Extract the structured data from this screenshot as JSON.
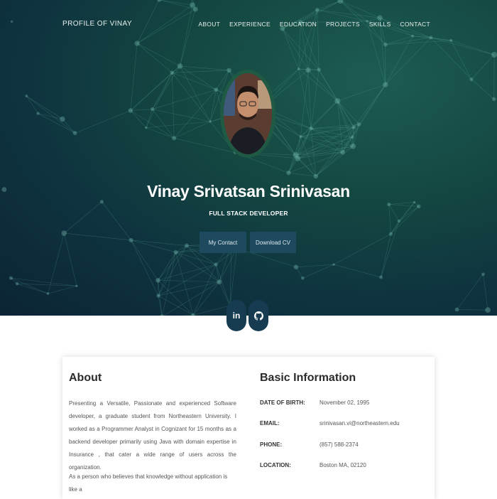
{
  "nav": {
    "brand": "PROFILE OF VINAY",
    "items": [
      "ABOUT",
      "EXPERIENCE",
      "EDUCATION",
      "PROJECTS",
      "SKILLS",
      "CONTACT"
    ]
  },
  "hero": {
    "name": "Vinay Srivatsan Srinivasan",
    "role": "FULL STACK DEVELOPER",
    "buttons": {
      "contact": "My Contact",
      "cv": "Download CV"
    }
  },
  "social": {
    "linkedin": "in"
  },
  "about": {
    "title": "About",
    "paragraph1": "Presenting a Versatile, Passionate and experienced Software developer, a graduate student from Northeastern University. I worked as a Programmer Analyst in Cognizant for 15 months as a backend developer primarily using Java with domain expertise in Insurance , that cater a wide range of users across the organization.",
    "paragraph2": "As a person who believes that knowledge without application is like a"
  },
  "basic_info": {
    "title": "Basic Information",
    "rows": [
      {
        "label": "DATE OF BIRTH:",
        "value": "November 02, 1995"
      },
      {
        "label": "EMAIL:",
        "value": "srinivasan.vi@northeastern.edu"
      },
      {
        "label": "PHONE:",
        "value": "(857) 588-2374"
      },
      {
        "label": "LOCATION:",
        "value": "Boston MA, 02120"
      }
    ]
  },
  "colors": {
    "hero_dark": "#0b2436",
    "hero_teal": "#1d5c52",
    "button": "#1e4a60",
    "social": "#173c52"
  },
  "icons": [
    "linkedin-icon",
    "github-icon",
    "profile-photo"
  ]
}
